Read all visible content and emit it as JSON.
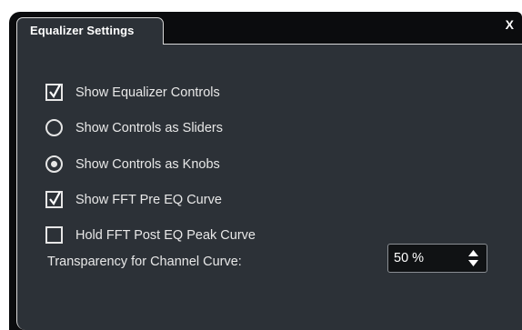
{
  "dialog": {
    "tab_title": "Equalizer Settings",
    "close_label": "X"
  },
  "options": [
    {
      "label": "Show Equalizer Controls",
      "type": "checkbox",
      "checked": true
    },
    {
      "label": "Show Controls as Sliders",
      "type": "radio",
      "checked": false
    },
    {
      "label": "Show Controls as Knobs",
      "type": "radio",
      "checked": true
    },
    {
      "label": "Show FFT Pre EQ Curve",
      "type": "checkbox",
      "checked": true
    },
    {
      "label": "Hold FFT Post EQ Peak Curve",
      "type": "checkbox",
      "checked": false
    }
  ],
  "transparency": {
    "label": "Transparency for Channel Curve:",
    "value": "50 %"
  },
  "colors": {
    "window_bg": "#0b0c0e",
    "panel_bg": "#2c3137",
    "border": "#d8d8d8",
    "text": "#e8e8e8"
  },
  "icons": {
    "close": "close-icon",
    "checkmark": "checkmark-icon",
    "spinner": "spinner-arrows-icon"
  }
}
